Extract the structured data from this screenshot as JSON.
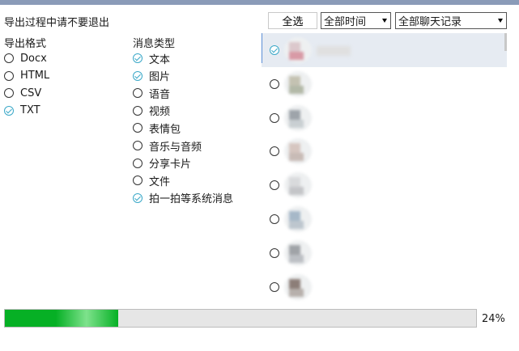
{
  "notice": "导出过程中请不要退出",
  "export_format": {
    "title": "导出格式",
    "options": [
      {
        "label": "Docx",
        "selected": false
      },
      {
        "label": "HTML",
        "selected": false
      },
      {
        "label": "CSV",
        "selected": false
      },
      {
        "label": "TXT",
        "selected": true
      }
    ]
  },
  "message_types": {
    "title": "消息类型",
    "options": [
      {
        "label": "文本",
        "checked": true
      },
      {
        "label": "图片",
        "checked": true
      },
      {
        "label": "语音",
        "checked": false
      },
      {
        "label": "视频",
        "checked": false
      },
      {
        "label": "表情包",
        "checked": false
      },
      {
        "label": "音乐与音频",
        "checked": false
      },
      {
        "label": "分享卡片",
        "checked": false
      },
      {
        "label": "文件",
        "checked": false
      },
      {
        "label": "拍一拍等系统消息",
        "checked": true
      }
    ]
  },
  "toolbar": {
    "select_all_label": "全选",
    "time_filter_value": "全部时间",
    "chat_filter_value": "全部聊天记录"
  },
  "chats": [
    {
      "selected": true,
      "avatar_colors": [
        "#dcc8cc",
        "#d89aa6"
      ]
    },
    {
      "selected": false,
      "avatar_colors": [
        "#c4c2b2",
        "#b3b9a8"
      ]
    },
    {
      "selected": false,
      "avatar_colors": [
        "#9ea4aa",
        "#c9cfd2"
      ]
    },
    {
      "selected": false,
      "avatar_colors": [
        "#d6c6c0",
        "#c8bbb6"
      ]
    },
    {
      "selected": false,
      "avatar_colors": [
        "#d9dadc",
        "#c4c5c8"
      ]
    },
    {
      "selected": false,
      "avatar_colors": [
        "#a6b8c8",
        "#bdc6ce"
      ]
    },
    {
      "selected": false,
      "avatar_colors": [
        "#a0a3a7",
        "#bcbfc4"
      ]
    },
    {
      "selected": false,
      "avatar_colors": [
        "#8c7e78",
        "#b7b0ac"
      ]
    }
  ],
  "progress": {
    "value": 0.24,
    "label": "24%"
  },
  "colors": {
    "check": "#3aa8c8",
    "progress": "#06b025",
    "accent_bar": "#8a9bb8"
  }
}
